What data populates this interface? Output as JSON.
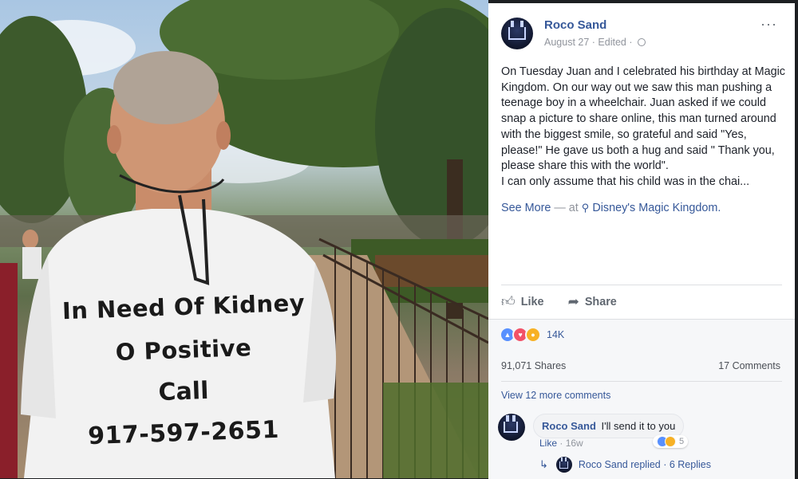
{
  "photo": {
    "shirt_lines": [
      "In Need Of Kidney",
      "O Positive",
      "Call",
      "917-597-2651"
    ]
  },
  "post": {
    "author": "Roco Sand",
    "meta": "August 27 · Edited ·",
    "more_icon": "···",
    "text_lines": [
      "On Tuesday Juan and I celebrated his birthday at Magic Kingdom. On our way out we saw this man pushing a teenage boy in a wheelchair. Juan asked if we could snap a picture to share online, this man turned around with the biggest smile, so grateful and said \"Yes, please!\" He gave us both a hug and said \" Thank you, please share this with the world\".",
      "I can only assume that his child was in the chai..."
    ],
    "see_more": "See More",
    "at_separator": " — at ",
    "location": "Disney's Magic Kingdom."
  },
  "actions": {
    "like_label": "Like",
    "share_label": "Share"
  },
  "stats": {
    "reactions_count": "14K",
    "shares": "91,071 Shares",
    "comments": "17 Comments"
  },
  "comments": {
    "view_more": "View 12 more comments",
    "items": [
      {
        "author": "Roco Sand",
        "text": "I'll send it to you",
        "reaction_count": "5",
        "like_label": "Like",
        "time": "16w",
        "reply_summary": "Roco Sand replied · 6 Replies"
      }
    ]
  },
  "icons": {
    "like": "thumbs-up-icon",
    "share": "share-arrow-icon",
    "globe": "globe-icon",
    "pin": "location-pin-icon"
  },
  "colors": {
    "link": "#365899",
    "muted": "#90949c",
    "like_blue": "#5890ff",
    "love_red": "#f25268",
    "sad_yellow": "#f7b125"
  }
}
